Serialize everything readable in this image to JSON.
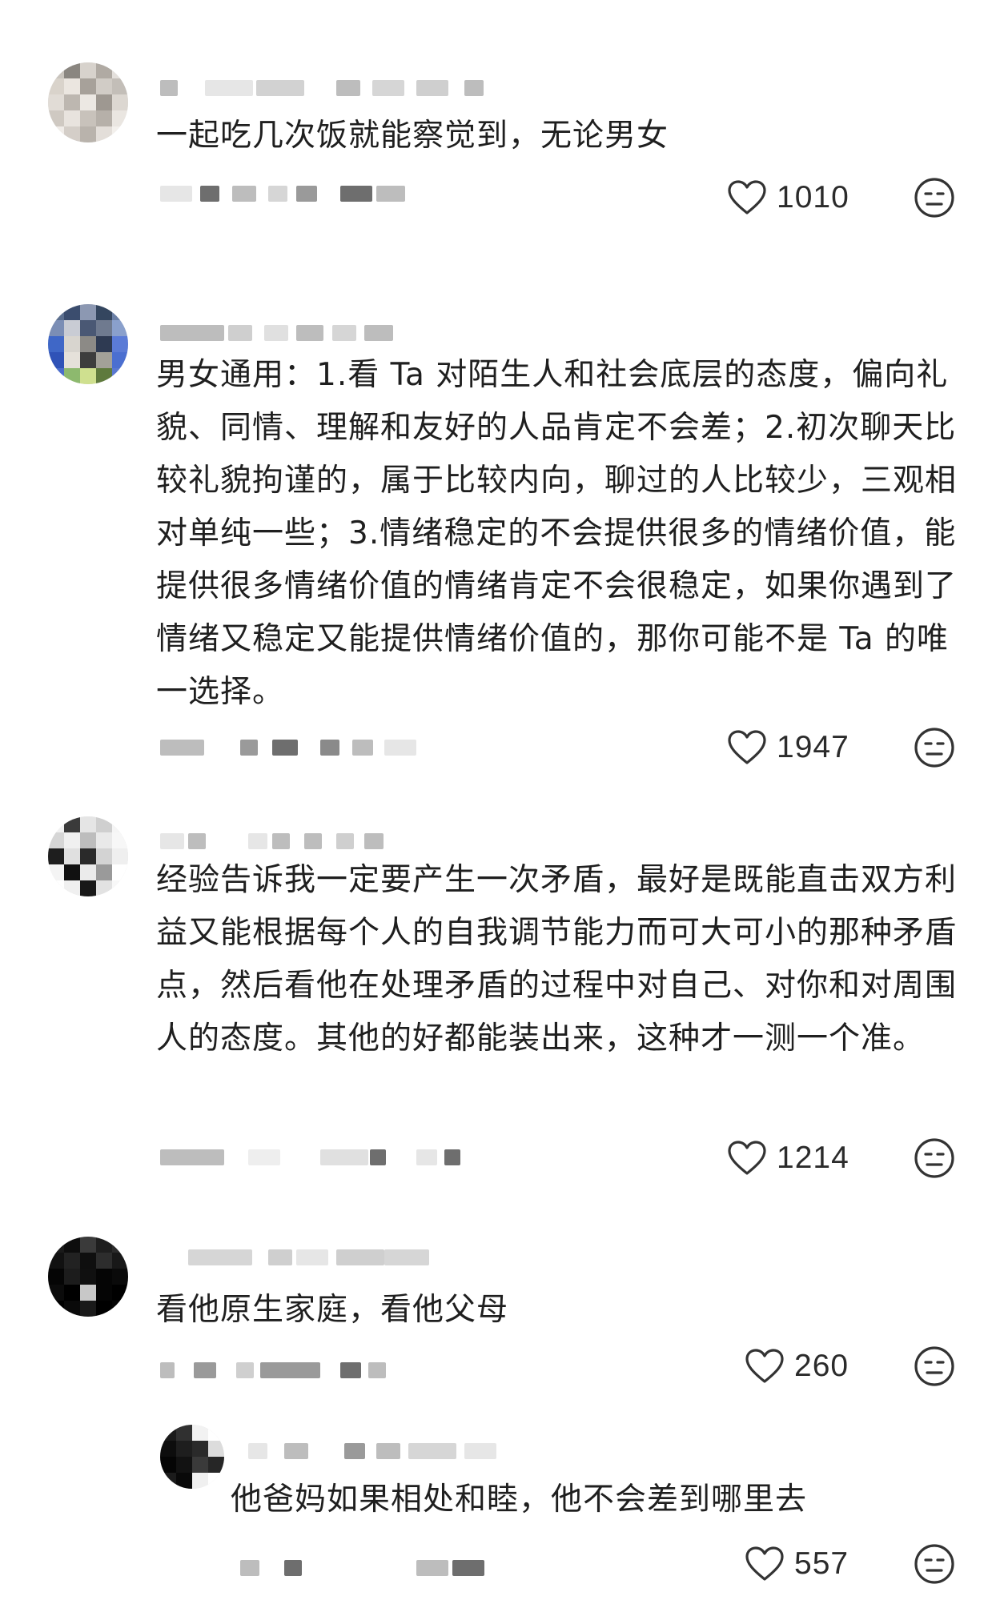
{
  "comments": [
    {
      "text": "一起吃几次饭就能察觉到，无论男女",
      "likes": "1010",
      "like_icon": "heart-outline-icon",
      "reply_icon": "neutral-face-icon"
    },
    {
      "text": "男女通用：1.看 Ta 对陌生人和社会底层的态度，偏向礼貌、同情、理解和友好的人品肯定不会差；2.初次聊天比较礼貌拘谨的，属于比较内向，聊过的人比较少，三观相对单纯一些；3.情绪稳定的不会提供很多的情绪价值，能提供很多情绪价值的情绪肯定不会很稳定，如果你遇到了情绪又稳定又能提供情绪价值的，那你可能不是 Ta 的唯一选择。",
      "likes": "1947",
      "like_icon": "heart-outline-icon",
      "reply_icon": "neutral-face-icon"
    },
    {
      "text": "经验告诉我一定要产生一次矛盾，最好是既能直击双方利益又能根据每个人的自我调节能力而可大可小的那种矛盾点，然后看他在处理矛盾的过程中对自己、对你和对周围人的态度。其他的好都能装出来，这种才一测一个准。",
      "likes": "1214",
      "like_icon": "heart-outline-icon",
      "reply_icon": "neutral-face-icon"
    },
    {
      "text": "看他原生家庭，看他父母",
      "likes": "260",
      "like_icon": "heart-outline-icon",
      "reply_icon": "neutral-face-icon"
    }
  ],
  "reply": {
    "text": "他爸妈如果相处和睦，他不会差到哪里去",
    "likes": "557",
    "like_icon": "heart-outline-icon",
    "reply_icon": "neutral-face-icon"
  },
  "colors": {
    "text": "#1f1f1f",
    "icon": "#333333",
    "blur_light": "#e6e6e6",
    "blur_mid": "#bdbdbd",
    "blur_dark": "#6e6e6e"
  }
}
